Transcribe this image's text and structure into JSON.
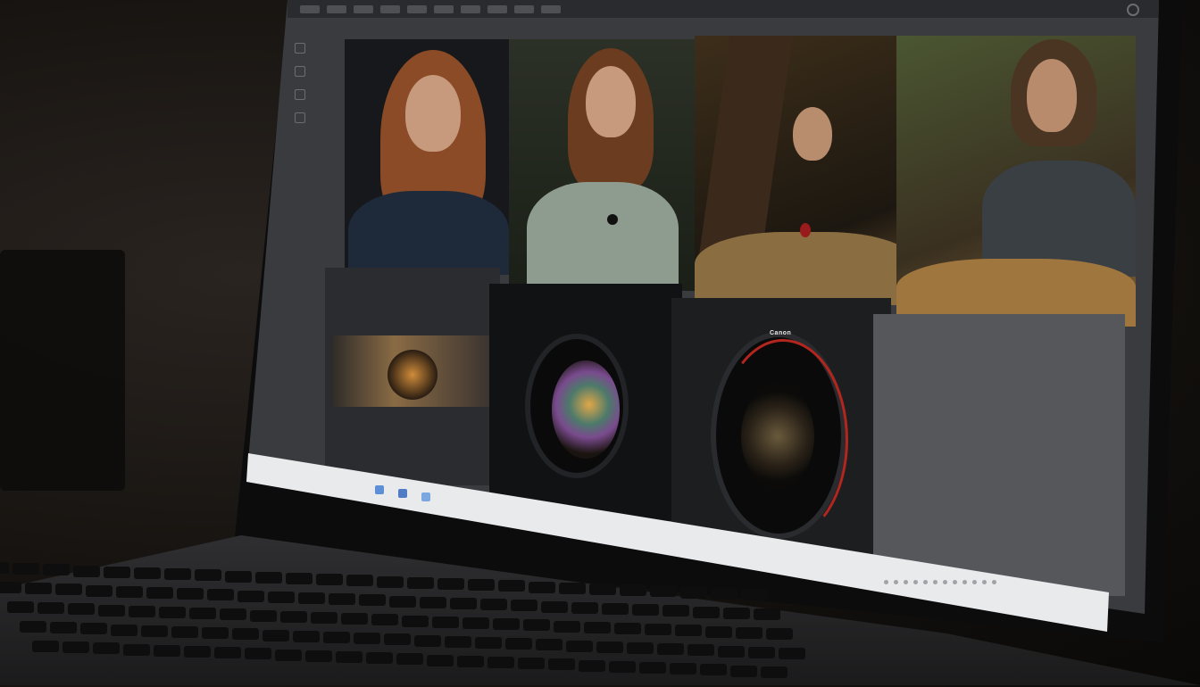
{
  "window": {
    "toolbar_buttons": [
      "btn-1",
      "btn-2",
      "btn-3",
      "btn-4",
      "btn-5",
      "btn-6",
      "btn-7",
      "btn-8",
      "btn-9",
      "btn-10"
    ]
  },
  "grid": {
    "cells": [
      {
        "id": "portrait-1",
        "tag": ""
      },
      {
        "id": "portrait-2",
        "tag": ""
      },
      {
        "id": "portrait-3",
        "tag": ""
      },
      {
        "id": "portrait-4",
        "tag": ""
      },
      {
        "id": "lens-1",
        "tag": ""
      },
      {
        "id": "lens-2",
        "tag": ""
      },
      {
        "id": "lens-3",
        "tag": "Canon"
      }
    ]
  },
  "lens_brand": "Canon",
  "colors": {
    "app_background": "#3a3b3e",
    "toolbar": "#2a2b2e",
    "dock": "#e9eaec",
    "dock_icon": "#5c8fd6"
  },
  "icons": [
    "menu-icon",
    "rail-grid-icon",
    "rail-folder-icon",
    "rail-star-icon",
    "rail-tag-icon",
    "dock-file-icon",
    "dock-folder-icon",
    "dock-edit-icon"
  ]
}
